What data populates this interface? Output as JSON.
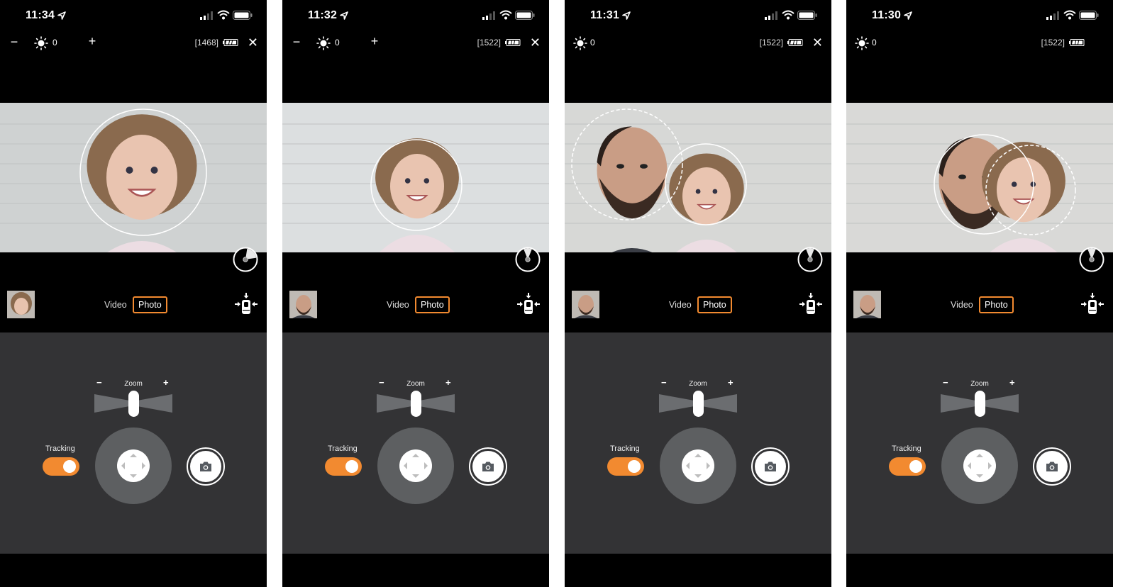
{
  "accent_color": "#f28a30",
  "panel_color": "#333335",
  "screens": [
    {
      "status": {
        "time": "11:34"
      },
      "toolbar": {
        "minus": "−",
        "exposure_value": "0",
        "plus": "+",
        "frame_count": "[1468]",
        "close": "✕",
        "show_exposure_buttons": true
      },
      "preview": {
        "scene": "girl-close",
        "tracking_circles": [
          {
            "style": "solid"
          }
        ]
      },
      "pie_indicator": {
        "fraction": 0.2,
        "direction": "top-right"
      },
      "thumbnail": "girl",
      "modes": {
        "video": "Video",
        "photo": "Photo",
        "selected": "Photo"
      },
      "controls": {
        "zoom_label": "Zoom",
        "zoom_minus": "−",
        "zoom_plus": "+",
        "zoom_level": 0.5,
        "tracking_label": "Tracking",
        "tracking_on": true
      }
    },
    {
      "status": {
        "time": "11:32"
      },
      "toolbar": {
        "minus": "−",
        "exposure_value": "0",
        "plus": "+",
        "frame_count": "[1522]",
        "close": "✕",
        "show_exposure_buttons": true
      },
      "preview": {
        "scene": "girl-waving",
        "tracking_circles": [
          {
            "style": "solid"
          }
        ]
      },
      "pie_indicator": {
        "fraction": 0.12,
        "direction": "top"
      },
      "thumbnail": "man",
      "modes": {
        "video": "Video",
        "photo": "Photo",
        "selected": "Photo"
      },
      "controls": {
        "zoom_label": "Zoom",
        "zoom_minus": "−",
        "zoom_plus": "+",
        "zoom_level": 0.5,
        "tracking_label": "Tracking",
        "tracking_on": true
      }
    },
    {
      "status": {
        "time": "11:31"
      },
      "toolbar": {
        "exposure_value": "0",
        "frame_count": "[1522]",
        "close": "✕",
        "show_exposure_buttons": false
      },
      "preview": {
        "scene": "man-and-girl",
        "tracking_circles": [
          {
            "style": "dashed"
          },
          {
            "style": "solid"
          }
        ]
      },
      "pie_indicator": {
        "fraction": 0.12,
        "direction": "top"
      },
      "thumbnail": "man",
      "modes": {
        "video": "Video",
        "photo": "Photo",
        "selected": "Photo"
      },
      "controls": {
        "zoom_label": "Zoom",
        "zoom_minus": "−",
        "zoom_plus": "+",
        "zoom_level": 0.5,
        "tracking_label": "Tracking",
        "tracking_on": true
      }
    },
    {
      "status": {
        "time": "11:30"
      },
      "toolbar": {
        "exposure_value": "0",
        "frame_count": "[1522]",
        "show_exposure_buttons": false
      },
      "preview": {
        "scene": "man-and-girl-close",
        "tracking_circles": [
          {
            "style": "solid"
          },
          {
            "style": "dashed"
          }
        ]
      },
      "pie_indicator": {
        "fraction": 0.12,
        "direction": "top"
      },
      "thumbnail": "man",
      "modes": {
        "video": "Video",
        "photo": "Photo",
        "selected": "Photo"
      },
      "controls": {
        "zoom_label": "Zoom",
        "zoom_minus": "−",
        "zoom_plus": "+",
        "zoom_level": 0.5,
        "tracking_label": "Tracking",
        "tracking_on": true
      }
    }
  ]
}
